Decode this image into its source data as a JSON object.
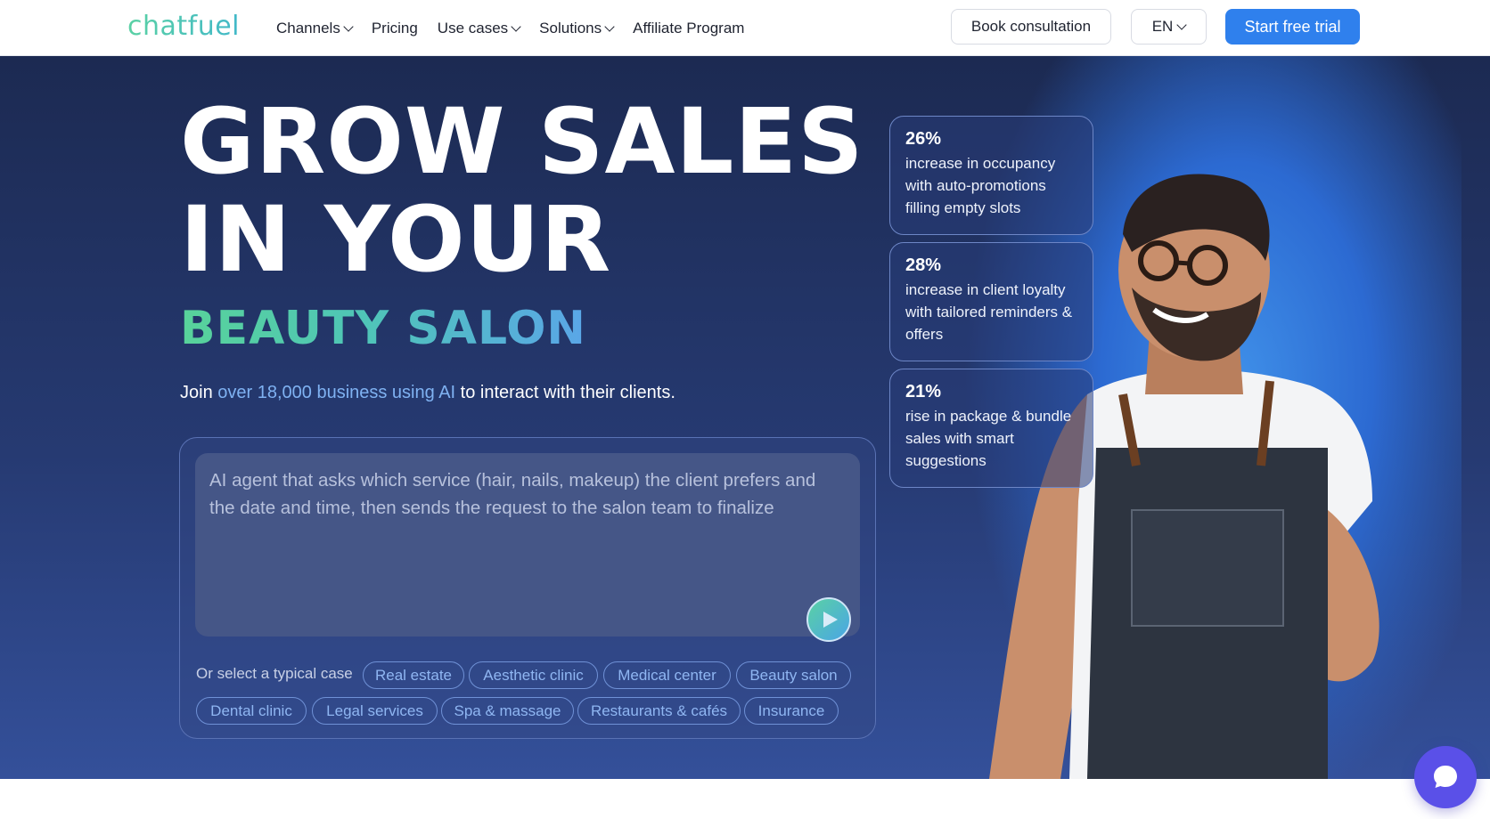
{
  "nav": {
    "logo": "chatfuel",
    "links": [
      {
        "label": "Channels",
        "dropdown": true
      },
      {
        "label": "Pricing",
        "dropdown": false
      },
      {
        "label": "Use cases",
        "dropdown": true
      },
      {
        "label": "Solutions",
        "dropdown": true
      },
      {
        "label": "Affiliate Program",
        "dropdown": false
      }
    ],
    "consult_label": "Book consultation",
    "lang_label": "EN",
    "trial_label": "Start free trial"
  },
  "hero": {
    "title_line1": "GROW SALES",
    "title_line2": "IN YOUR",
    "subtitle": "BEAUTY SALON",
    "lead_prefix": "Join ",
    "lead_highlight": "over 18,000 business using AI",
    "lead_suffix": " to interact with their clients.",
    "prompt_text": "AI agent that asks which service (hair, nails, makeup) the client prefers and the date and time, then sends the request to the salon team to finalize",
    "cases_label": "Or select a typical case",
    "cases": [
      "Real estate",
      "Aesthetic clinic",
      "Medical center",
      "Beauty salon",
      "Dental clinic",
      "Legal services",
      "Spa & massage",
      "Restaurants & cafés",
      "Insurance"
    ]
  },
  "stats": [
    {
      "value": "26%",
      "text": "increase in occupancy with auto-promotions filling empty slots"
    },
    {
      "value": "28%",
      "text": "increase in client loyalty with tailored reminders & offers"
    },
    {
      "value": "21%",
      "text": "rise in package & bundle sales with smart suggestions"
    }
  ],
  "colors": {
    "brand_blue": "#2f80ed",
    "hero_dark": "#1c2a52",
    "accent_green": "#58d39a",
    "chat_purple": "#5a50e8"
  }
}
